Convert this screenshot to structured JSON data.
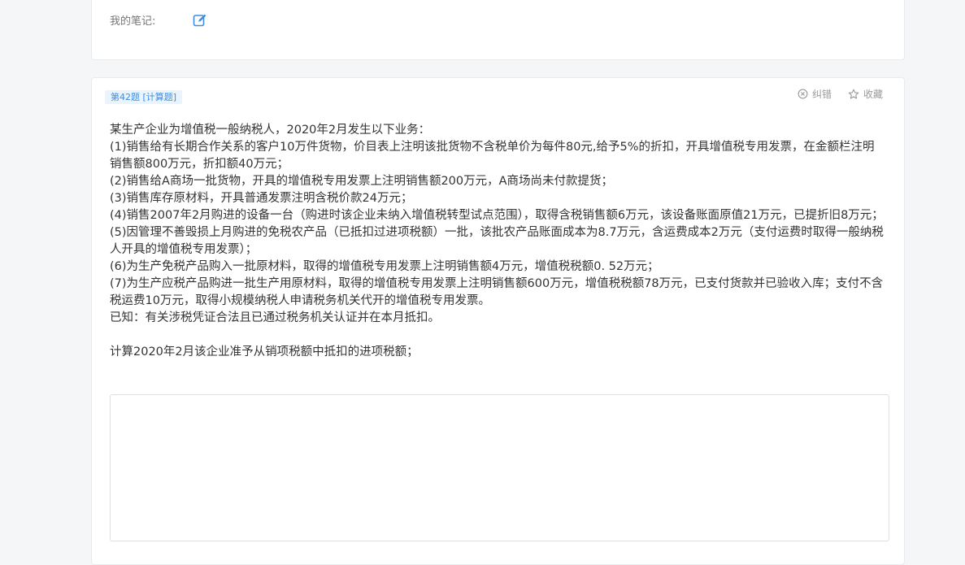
{
  "notes": {
    "label": "我的笔记:"
  },
  "question": {
    "tag": "第42题 [计算题]",
    "actions": {
      "correct_label": "纠错",
      "favorite_label": "收藏"
    },
    "lines": [
      "某生产企业为增值税一般纳税人，2020年2月发生以下业务：",
      "(1)销售给有长期合作关系的客户10万件货物，价目表上注明该批货物不含税单价为每件80元,给予5%的折扣，开具增值税专用发票，在金额栏注明销售额800万元，折扣额40万元；",
      "(2)销售给A商场一批货物，开具的增值税专用发票上注明销售额200万元，A商场尚未付款提货；",
      "(3)销售库存原材料，开具普通发票注明含税价款24万元；",
      "(4)销售2007年2月购进的设备一台（购进时该企业未纳入增值税转型试点范围），取得含税销售额6万元，该设备账面原值21万元，已提折旧8万元；",
      "(5)因管理不善毁损上月购进的免税农产品（已抵扣过进项税额）一批，该批农产品账面成本为8.7万元，含运费成本2万元（支付运费时取得一般纳税人开具的增值税专用发票）；",
      "(6)为生产免税产品购入一批原材料，取得的增值税专用发票上注明销售额4万元，增值税税额0. 52万元；",
      "(7)为生产应税产品购进一批生产用原材料，取得的增值税专用发票上注明销售额600万元，增值税税额78万元，已支付货款并已验收入库；支付不含税运费10万元，取得小规模纳税人申请税务机关代开的增值税专用发票。",
      "已知：有关涉税凭证合法且已通过税务机关认证并在本月抵扣。"
    ],
    "prompt": "计算2020年2月该企业准予从销项税额中抵扣的进项税额；",
    "answer": {
      "value": "",
      "placeholder": ""
    }
  },
  "colors": {
    "accent": "#3a8ee6",
    "tag_bg": "#eaf4fd",
    "muted": "#999999",
    "border": "#dcdfe6",
    "page_bg": "#f5f6f7"
  }
}
